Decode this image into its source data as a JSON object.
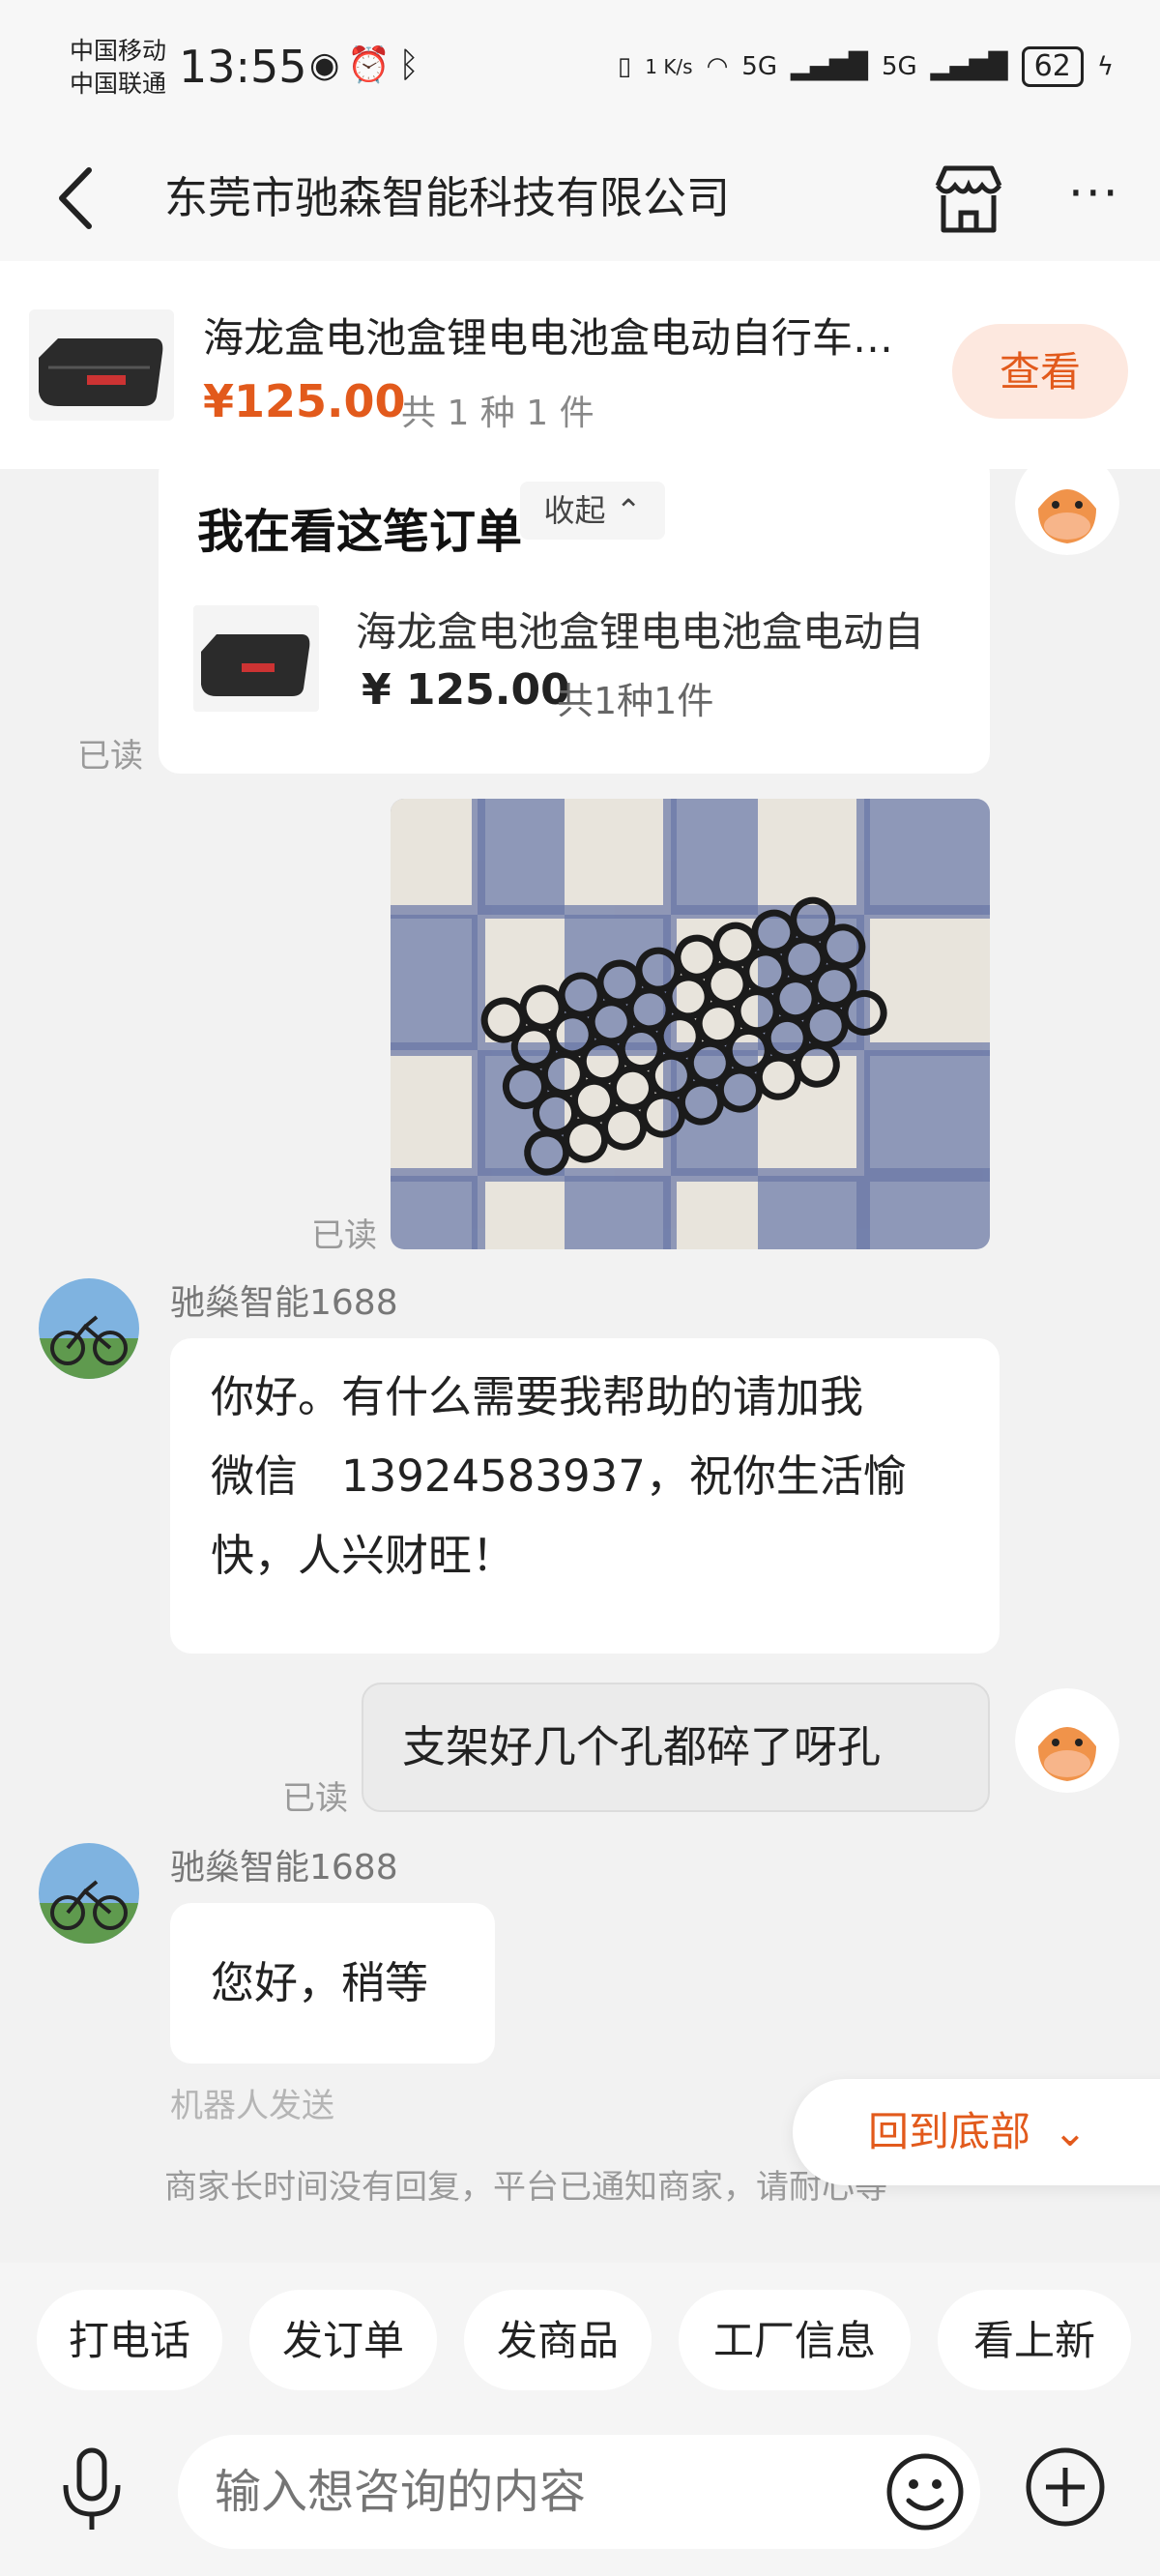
{
  "status": {
    "carrier1": "中国移动",
    "carrier2": "中国联通",
    "time": "13:55",
    "net_speed": "1 K/s",
    "net1": "5G",
    "net2": "5G",
    "battery": "62"
  },
  "header": {
    "title": "东莞市驰森智能科技有限公司",
    "back_icon": "chevron-left-icon",
    "store_icon": "store-icon",
    "more_icon": "more-dots-icon"
  },
  "product": {
    "name": "海龙盒电池盒锂电电池盒电动自行车…",
    "price": "¥125.00",
    "qty": "共 1 种 1 件",
    "view_label": "查看"
  },
  "order_card": {
    "title": "我在看这笔订单",
    "collapse_label": "收起",
    "name": "海龙盒电池盒锂电电池盒电动自",
    "price": "¥ 125.00",
    "qty": "共1种1件",
    "read": "已读"
  },
  "photo_msg": {
    "read": "已读"
  },
  "msg1": {
    "sender": "驰燊智能1688",
    "text_lines": [
      "你好。有什么需要我帮助的请加我",
      "微信　13924583937，祝你生活愉",
      "快，人兴财旺！"
    ]
  },
  "msg2": {
    "text": "支架好几个孔都碎了呀孔",
    "read": "已读"
  },
  "msg3": {
    "sender": "驰燊智能1688",
    "text": "您好，稍等",
    "robot": "机器人发送"
  },
  "notice": "商家长时间没有回复，平台已通知商家，请耐心等",
  "back_to_bottom": "回到底部",
  "quick_actions": [
    "打电话",
    "发订单",
    "发商品",
    "工厂信息",
    "看上新"
  ],
  "input": {
    "placeholder": "输入想咨询的内容"
  },
  "colors": {
    "accent": "#e25a1c",
    "bg": "#f2f2f2"
  }
}
